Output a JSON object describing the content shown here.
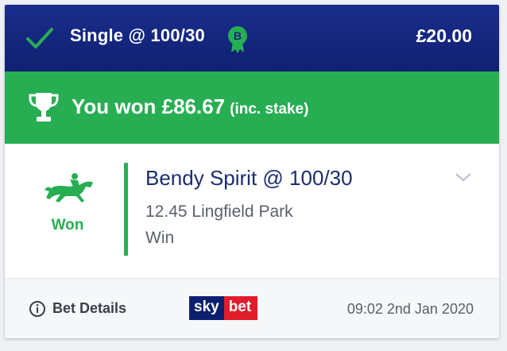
{
  "header": {
    "title": "Single @ 100/30",
    "badge_letter": "B",
    "stake": "£20.00",
    "status_icon": "check-icon",
    "colors": {
      "bg": "#14287f",
      "check": "#27ae52",
      "badge": "#27ae52"
    }
  },
  "result_banner": {
    "text": "You won £86.67",
    "subtext": "(inc. stake)",
    "icon": "trophy-icon",
    "color": "#27ae52"
  },
  "selection": {
    "result": "Won",
    "name": "Bendy Spirit @ 100/30",
    "race": "12.45 Lingfield Park",
    "market": "Win",
    "icon": "horse-racing-icon",
    "accent": "#27ae52"
  },
  "footer": {
    "details_label": "Bet Details",
    "logo_sky": "sky",
    "logo_bet": "bet",
    "timestamp": "09:02 2nd Jan 2020"
  }
}
